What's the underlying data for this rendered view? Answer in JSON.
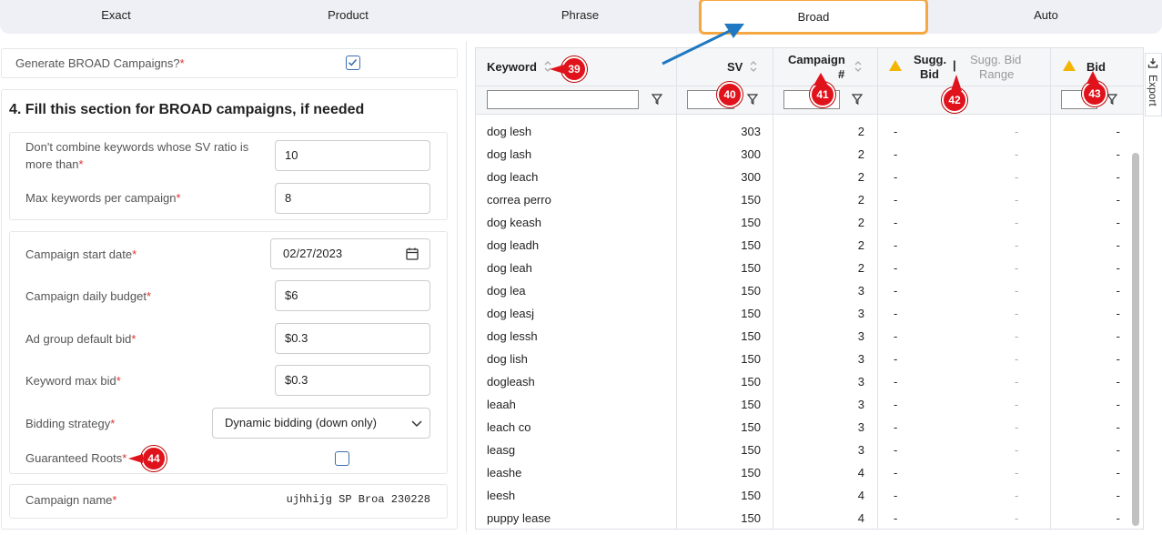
{
  "tabs": [
    {
      "label": "Exact"
    },
    {
      "label": "Product"
    },
    {
      "label": "Phrase"
    },
    {
      "label": "Broad",
      "active": true
    },
    {
      "label": "Auto"
    }
  ],
  "left": {
    "generate_label": "Generate BROAD Campaigns?",
    "generate_checked": true,
    "section_title": "4. Fill this section for BROAD campaigns, if needed",
    "sv_ratio_label": "Don't combine keywords whose SV ratio is more than",
    "sv_ratio_value": "10",
    "max_kw_label": "Max keywords per campaign",
    "max_kw_value": "8",
    "start_date_label": "Campaign start date",
    "start_date_value": "02/27/2023",
    "daily_budget_label": "Campaign daily budget",
    "daily_budget_value": "$6",
    "adgroup_bid_label": "Ad group default bid",
    "adgroup_bid_value": "$0.3",
    "kw_max_bid_label": "Keyword max bid",
    "kw_max_bid_value": "$0.3",
    "bidding_label": "Bidding strategy",
    "bidding_value": "Dynamic bidding (down only)",
    "roots_label": "Guaranteed Roots",
    "roots_checked": false,
    "campaign_name_label": "Campaign name",
    "campaign_name_value": "ujhhijg SP Broa 230228",
    "required_mark": "*"
  },
  "grid": {
    "headers": {
      "keyword": "Keyword",
      "sv": "SV",
      "campaign_line1": "Campaign",
      "campaign_line2": "#",
      "sugg_line1": "Sugg.",
      "sugg_line2": "Bid",
      "sep": "|",
      "range_line1": "Sugg. Bid",
      "range_line2": "Range",
      "bid": "Bid"
    },
    "rows": [
      {
        "keyword": "dog lesh",
        "sv": "303",
        "campaign": "2",
        "sugg": "-",
        "range": "-",
        "bid": "-"
      },
      {
        "keyword": "dog lash",
        "sv": "300",
        "campaign": "2",
        "sugg": "-",
        "range": "-",
        "bid": "-"
      },
      {
        "keyword": "dog leach",
        "sv": "300",
        "campaign": "2",
        "sugg": "-",
        "range": "-",
        "bid": "-"
      },
      {
        "keyword": "correa perro",
        "sv": "150",
        "campaign": "2",
        "sugg": "-",
        "range": "-",
        "bid": "-"
      },
      {
        "keyword": "dog keash",
        "sv": "150",
        "campaign": "2",
        "sugg": "-",
        "range": "-",
        "bid": "-"
      },
      {
        "keyword": "dog leadh",
        "sv": "150",
        "campaign": "2",
        "sugg": "-",
        "range": "-",
        "bid": "-"
      },
      {
        "keyword": "dog leah",
        "sv": "150",
        "campaign": "2",
        "sugg": "-",
        "range": "-",
        "bid": "-"
      },
      {
        "keyword": "dog lea",
        "sv": "150",
        "campaign": "3",
        "sugg": "-",
        "range": "-",
        "bid": "-"
      },
      {
        "keyword": "dog leasj",
        "sv": "150",
        "campaign": "3",
        "sugg": "-",
        "range": "-",
        "bid": "-"
      },
      {
        "keyword": "dog lessh",
        "sv": "150",
        "campaign": "3",
        "sugg": "-",
        "range": "-",
        "bid": "-"
      },
      {
        "keyword": "dog lish",
        "sv": "150",
        "campaign": "3",
        "sugg": "-",
        "range": "-",
        "bid": "-"
      },
      {
        "keyword": "dogleash",
        "sv": "150",
        "campaign": "3",
        "sugg": "-",
        "range": "-",
        "bid": "-"
      },
      {
        "keyword": "leaah",
        "sv": "150",
        "campaign": "3",
        "sugg": "-",
        "range": "-",
        "bid": "-"
      },
      {
        "keyword": "leach co",
        "sv": "150",
        "campaign": "3",
        "sugg": "-",
        "range": "-",
        "bid": "-"
      },
      {
        "keyword": "leasg",
        "sv": "150",
        "campaign": "3",
        "sugg": "-",
        "range": "-",
        "bid": "-"
      },
      {
        "keyword": "leashe",
        "sv": "150",
        "campaign": "4",
        "sugg": "-",
        "range": "-",
        "bid": "-"
      },
      {
        "keyword": "leesh",
        "sv": "150",
        "campaign": "4",
        "sugg": "-",
        "range": "-",
        "bid": "-"
      },
      {
        "keyword": "puppy lease",
        "sv": "150",
        "campaign": "4",
        "sugg": "-",
        "range": "-",
        "bid": "-"
      }
    ],
    "export_label": "Export"
  },
  "callouts": [
    "39",
    "40",
    "41",
    "42",
    "43",
    "44"
  ],
  "colors": {
    "active_tab_border": "#f5a742",
    "badge": "#e0121b",
    "arrow": "#1f78c1",
    "warning": "#f5b400",
    "required": "#d33"
  }
}
